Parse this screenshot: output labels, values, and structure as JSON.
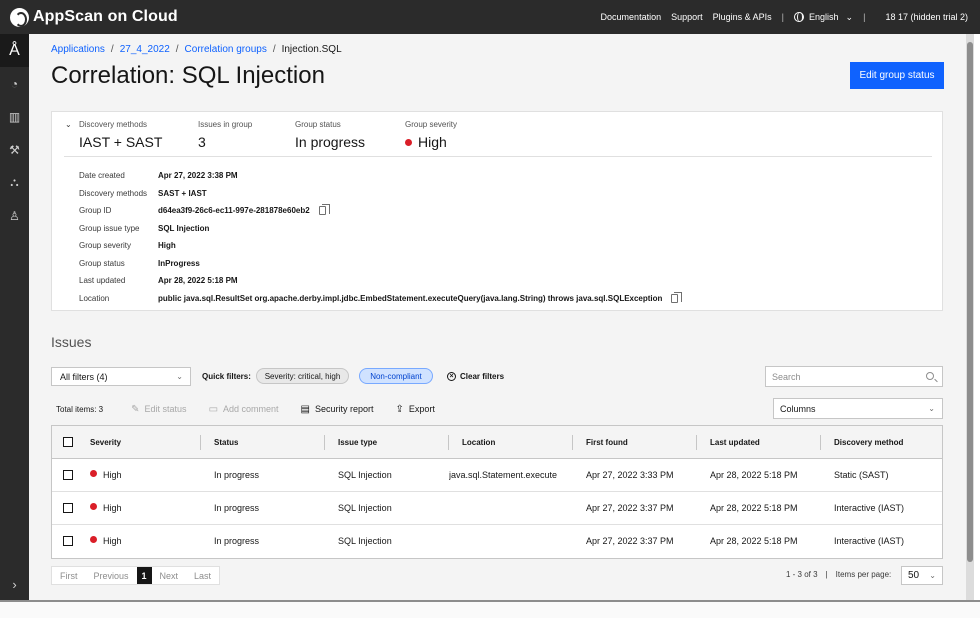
{
  "app": {
    "brand": "AppScan on Cloud",
    "nav": [
      "Documentation",
      "Support",
      "Plugins & APIs"
    ],
    "language": "English",
    "user": "18 17 (hidden trial 2)"
  },
  "rail": {
    "icons": [
      "appscan-logo-icon",
      "scan-icon",
      "reports-chart-icon",
      "tools-wrench-icon",
      "hierarchy-icon",
      "user-icon",
      "expand-chevron-icon"
    ]
  },
  "breadcrumb": [
    "Applications",
    "27_4_2022",
    "Correlation groups",
    "Injection.SQL"
  ],
  "page": {
    "title": "Correlation: SQL Injection",
    "edit_button": "Edit group status"
  },
  "summary": {
    "discovery_methods_label": "Discovery methods",
    "discovery_methods_value": "IAST + SAST",
    "issues_in_group_label": "Issues in group",
    "issues_in_group_value": "3",
    "group_status_label": "Group status",
    "group_status_value": "In progress",
    "group_severity_label": "Group severity",
    "group_severity_value": "High",
    "severity_color": "#da1e28"
  },
  "details": [
    {
      "key": "Date created",
      "value": "Apr 27, 2022 3:38 PM"
    },
    {
      "key": "Discovery methods",
      "value": "SAST + IAST"
    },
    {
      "key": "Group ID",
      "value": "d64ea3f9-26c6-ec11-997e-281878e60eb2"
    },
    {
      "key": "Group issue type",
      "value": "SQL Injection"
    },
    {
      "key": "Group severity",
      "value": "High"
    },
    {
      "key": "Group status",
      "value": "InProgress"
    },
    {
      "key": "Last updated",
      "value": "Apr 28, 2022 5:18 PM"
    },
    {
      "key": "Location",
      "value": "public java.sql.ResultSet org.apache.derby.impl.jdbc.EmbedStatement.executeQuery(java.lang.String) throws java.sql.SQLException"
    }
  ],
  "issues": {
    "heading": "Issues",
    "filter_select": "All filters (4)",
    "quick_filters_label": "Quick filters:",
    "tag_severity": "Severity: critical, high",
    "tag_noncompliant": "Non-compliant",
    "clear_filters": "Clear filters",
    "search_placeholder": "Search",
    "total_items": "Total items: 3",
    "edit_status": "Edit status",
    "add_comment": "Add comment",
    "security_report": "Security report",
    "export": "Export",
    "columns": "Columns"
  },
  "table": {
    "headers": [
      "Severity",
      "Status",
      "Issue type",
      "Location",
      "First found",
      "Last updated",
      "Discovery method"
    ],
    "rows": [
      [
        "High",
        "In progress",
        "SQL Injection",
        "java.sql.Statement.execute",
        "Apr 27, 2022 3:33 PM",
        "Apr 28, 2022 5:18 PM",
        "Static (SAST)"
      ],
      [
        "High",
        "In progress",
        "SQL Injection",
        "",
        "Apr 27, 2022 3:37 PM",
        "Apr 28, 2022 5:18 PM",
        "Interactive (IAST)"
      ],
      [
        "High",
        "In progress",
        "SQL Injection",
        "",
        "Apr 27, 2022 3:37 PM",
        "Apr 28, 2022 5:18 PM",
        "Interactive (IAST)"
      ]
    ]
  },
  "pager": {
    "first": "First",
    "previous": "Previous",
    "current": "1",
    "next": "Next",
    "last": "Last",
    "range": "1 - 3 of 3",
    "items_per_page_label": "Items per page:",
    "items_per_page": "50"
  }
}
